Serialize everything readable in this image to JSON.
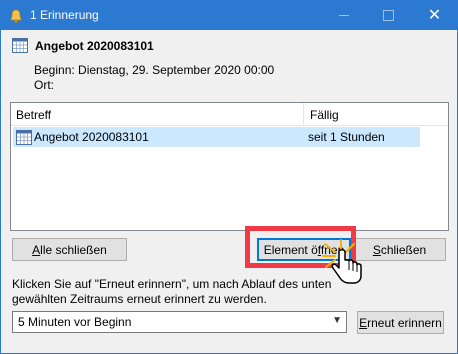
{
  "window": {
    "title": "1 Erinnerung",
    "titlebar_color": "#2b79d0",
    "controls": {
      "minimize": "minimize-icon",
      "maximize": "maximize-icon",
      "close": "✕"
    }
  },
  "reminder": {
    "subject": "Angebot 2020083101",
    "start_text": "Beginn: Dienstag, 29. September 2020 00:00",
    "location_text": "Ort:"
  },
  "list": {
    "columns": [
      "Betreff",
      "Fällig"
    ],
    "rows": [
      {
        "subject": "Angebot 2020083101",
        "due": "seit 1 Stunden"
      }
    ],
    "selected_row_color": "#cce8ff"
  },
  "buttons": {
    "dismiss_all": {
      "mnemonic": "A",
      "rest": "lle schließen"
    },
    "open_item": {
      "before": "Element ö",
      "mnemonic": "f",
      "after": "fnen"
    },
    "dismiss": {
      "mnemonic": "S",
      "rest": "chließen"
    },
    "snooze": {
      "mnemonic": "E",
      "rest": "rneut erinnern"
    }
  },
  "hint_text": "Klicken Sie auf \"Erneut erinnern\", um nach Ablauf des unten gewählten Zeitraums erneut erinnert zu werden.",
  "snooze_select": {
    "value": "5 Minuten vor Beginn"
  },
  "annotation": {
    "highlight_color": "#ef3b45",
    "target": "open-item-button"
  }
}
